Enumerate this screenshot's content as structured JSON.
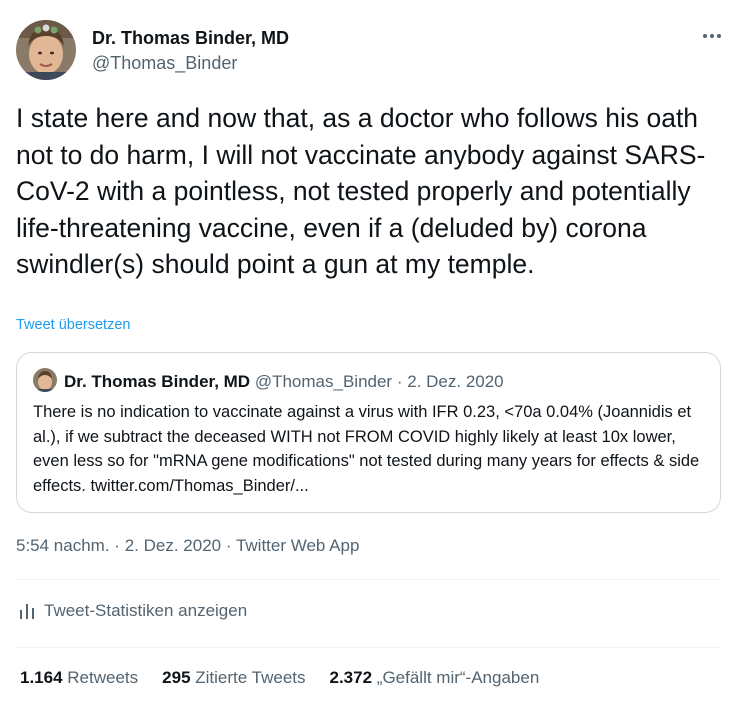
{
  "author": {
    "name": "Dr. Thomas Binder, MD",
    "handle": "@Thomas_Binder"
  },
  "tweet": {
    "text": "I state here and now that, as a doctor who follows his oath not to do harm, I will not vaccinate anybody against SARS-CoV-2 with a pointless, not tested properly and potentially life-threatening vaccine, even if a (deluded by) corona swindler(s) should point a gun at my temple.",
    "translate_label": "Tweet übersetzen"
  },
  "quoted": {
    "name": "Dr. Thomas Binder, MD",
    "handle": "@Thomas_Binder",
    "separator": "·",
    "date": "2. Dez. 2020",
    "text": "There is no indication to vaccinate against a virus with IFR 0.23, <70a 0.04% (Joannidis et al.), if we subtract the deceased WITH not FROM COVID highly likely at least 10x lower, even less so for \"mRNA gene modifications\" not tested during many years for effects & side effects. twitter.com/Thomas_Binder/..."
  },
  "meta": {
    "time": "5:54 nachm.",
    "sep1": "·",
    "date": "2. Dez. 2020",
    "sep2": "·",
    "source": "Twitter Web App"
  },
  "analytics": {
    "label": "Tweet-Statistiken anzeigen"
  },
  "counts": {
    "retweets_value": "1.164",
    "retweets_label": "Retweets",
    "quotes_value": "295",
    "quotes_label": "Zitierte Tweets",
    "likes_value": "2.372",
    "likes_label": "„Gefällt mir“-Angaben"
  },
  "colors": {
    "accent": "#1d9bf0",
    "text_primary": "#0f1419",
    "text_secondary": "#536471",
    "border": "#cfd9de"
  }
}
